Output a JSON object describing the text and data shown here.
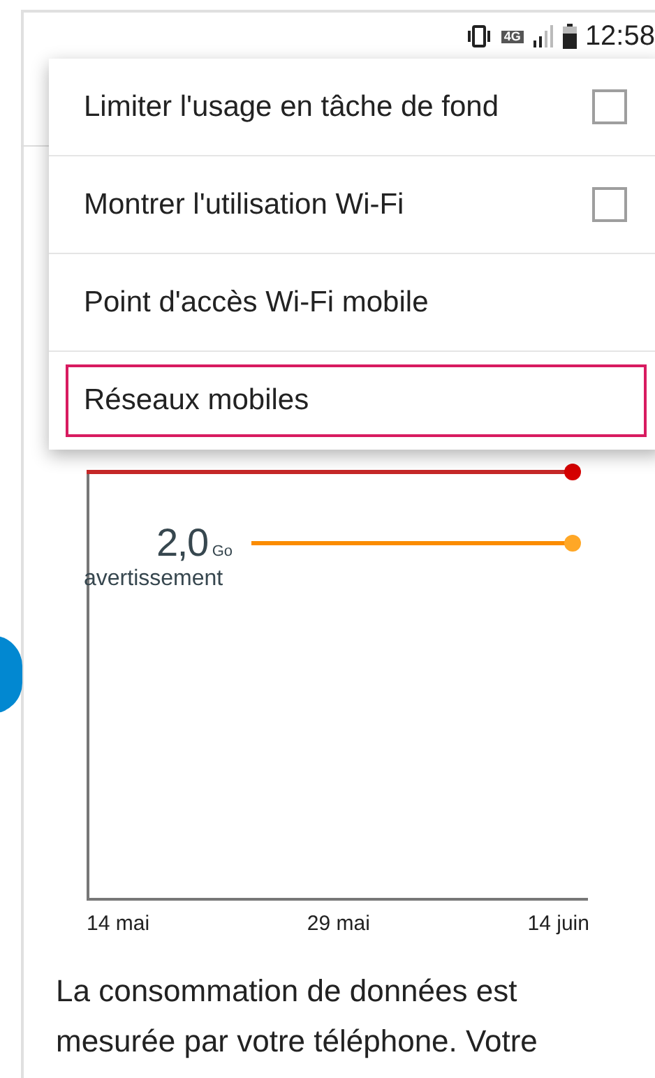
{
  "status_bar": {
    "time": "12:58",
    "network": "4G"
  },
  "menu": {
    "items": [
      {
        "label": "Limiter l'usage en tâche de fond",
        "kind": "checkbox",
        "checked": false,
        "selected": false
      },
      {
        "label": "Montrer l'utilisation Wi-Fi",
        "kind": "checkbox",
        "checked": false,
        "selected": false
      },
      {
        "label": "Point d'accès Wi-Fi mobile",
        "kind": "plain",
        "selected": false
      },
      {
        "label": "Réseaux mobiles",
        "kind": "plain",
        "selected": true
      }
    ]
  },
  "chart": {
    "warning": {
      "value": "2,0",
      "unit": "Go",
      "label": "avertissement"
    },
    "x_labels": [
      "14 mai",
      "29 mai",
      "14 juin"
    ]
  },
  "description": "La consommation de données est mesurée par votre téléphone. Votre"
}
